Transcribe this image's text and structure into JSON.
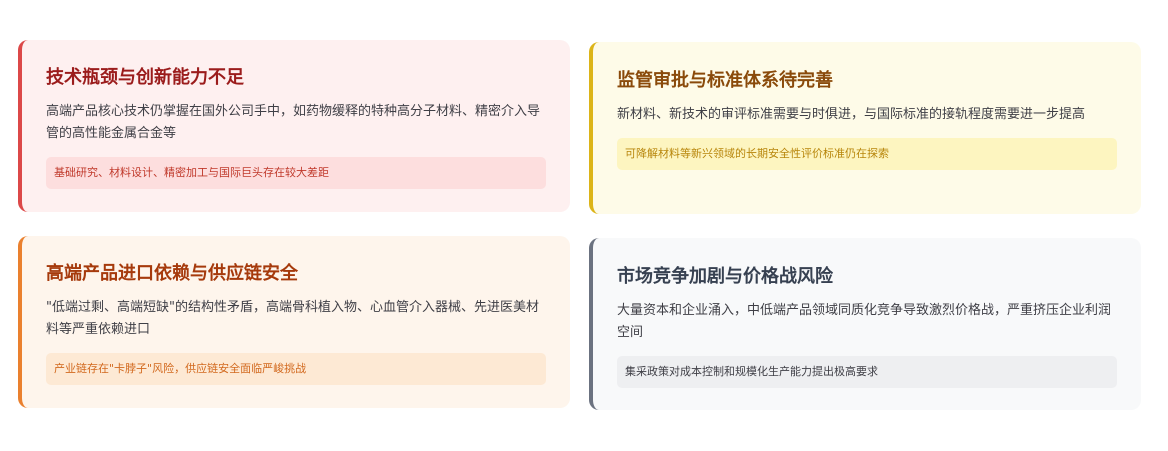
{
  "cards": [
    {
      "title": "技术瓶颈与创新能力不足",
      "description": "高端产品核心技术仍掌握在国外公司手中，如药物缓释的特种高分子材料、精密介入导管的高性能金属合金等",
      "note": "基础研究、材料设计、精密加工与国际巨头存在较大差距",
      "accent_color": "#dc4848"
    },
    {
      "title": "监管审批与标准体系待完善",
      "description": "新材料、新技术的审评标准需要与时俱进，与国际标准的接轨程度需要进一步提高",
      "note": "可降解材料等新兴领域的长期安全性评价标准仍在探索",
      "accent_color": "#dcb418"
    },
    {
      "title": "高端产品进口依赖与供应链安全",
      "description": "\"低端过剩、高端短缺\"的结构性矛盾，高端骨科植入物、心血管介入器械、先进医美材料等严重依赖进口",
      "note": "产业链存在\"卡脖子\"风险，供应链安全面临严峻挑战",
      "accent_color": "#ea802e"
    },
    {
      "title": "市场竞争加剧与价格战风险",
      "description": "大量资本和企业涌入，中低端产品领域同质化竞争导致激烈价格战，严重挤压企业利润空间",
      "note": "集采政策对成本控制和规模化生产能力提出极高要求",
      "accent_color": "#6b7280"
    }
  ]
}
